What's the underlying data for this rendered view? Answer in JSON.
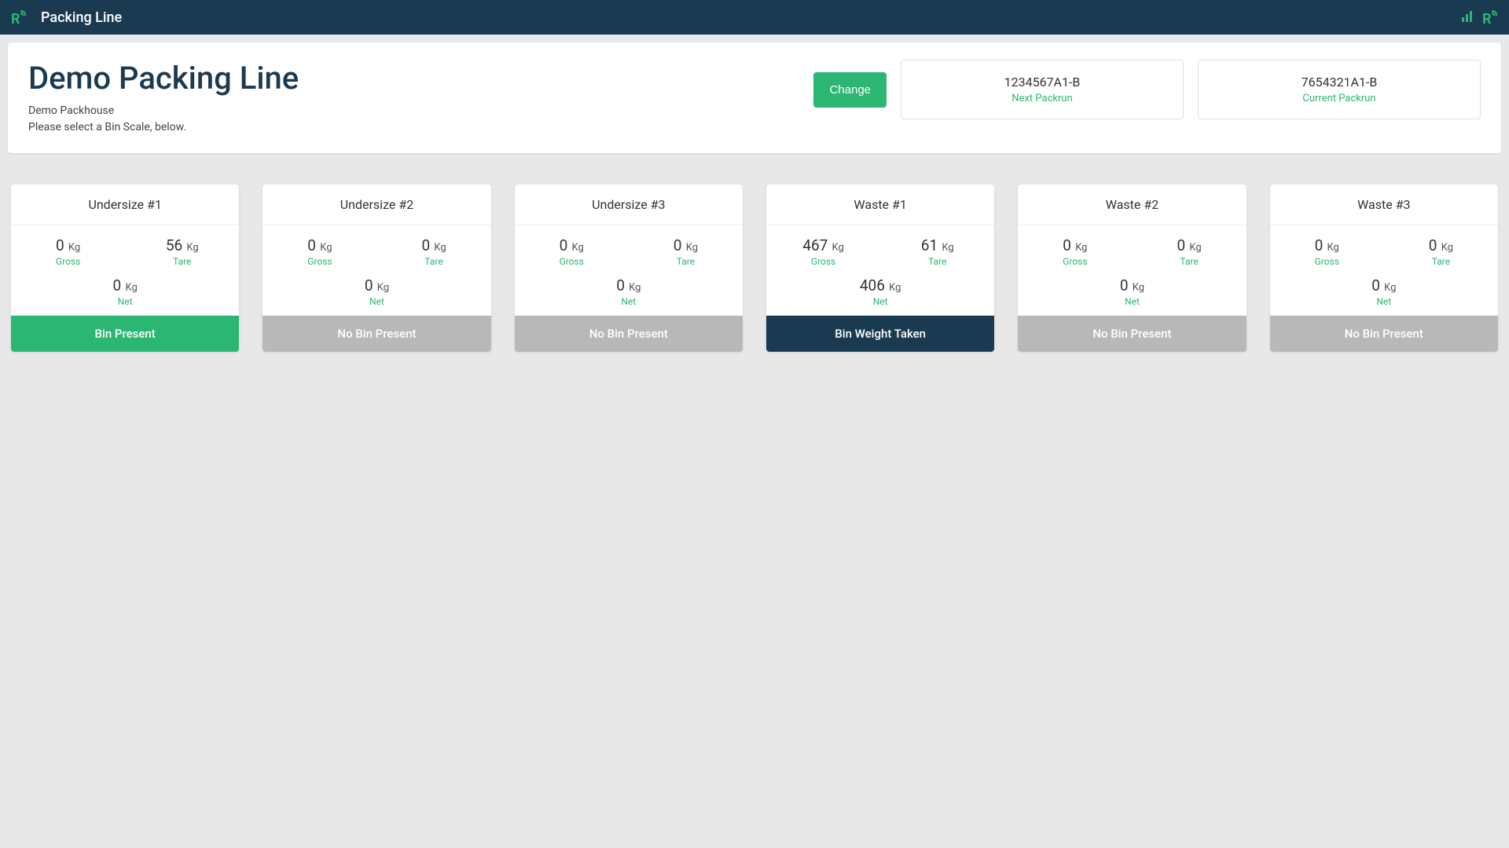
{
  "navbar": {
    "title": "Packing Line"
  },
  "header": {
    "title": "Demo Packing Line",
    "subtitle1": "Demo Packhouse",
    "subtitle2": "Please select a Bin Scale, below.",
    "change_button": "Change"
  },
  "packruns": {
    "next": {
      "id": "1234567A1-B",
      "label": "Next Packrun"
    },
    "current": {
      "id": "7654321A1-B",
      "label": "Current Packrun"
    }
  },
  "labels": {
    "kg": "Kg",
    "gross": "Gross",
    "tare": "Tare",
    "net": "Net"
  },
  "status": {
    "bin_present": "Bin Present",
    "no_bin_present": "No Bin Present",
    "bin_weight_taken": "Bin Weight Taken"
  },
  "bins": [
    {
      "name": "Undersize #1",
      "gross": "0",
      "tare": "56",
      "net": "0",
      "status": "bin_present",
      "status_class": "present"
    },
    {
      "name": "Undersize #2",
      "gross": "0",
      "tare": "0",
      "net": "0",
      "status": "no_bin_present",
      "status_class": "no-bin"
    },
    {
      "name": "Undersize #3",
      "gross": "0",
      "tare": "0",
      "net": "0",
      "status": "no_bin_present",
      "status_class": "no-bin"
    },
    {
      "name": "Waste #1",
      "gross": "467",
      "tare": "61",
      "net": "406",
      "status": "bin_weight_taken",
      "status_class": "weight-taken"
    },
    {
      "name": "Waste #2",
      "gross": "0",
      "tare": "0",
      "net": "0",
      "status": "no_bin_present",
      "status_class": "no-bin"
    },
    {
      "name": "Waste #3",
      "gross": "0",
      "tare": "0",
      "net": "0",
      "status": "no_bin_present",
      "status_class": "no-bin"
    }
  ]
}
